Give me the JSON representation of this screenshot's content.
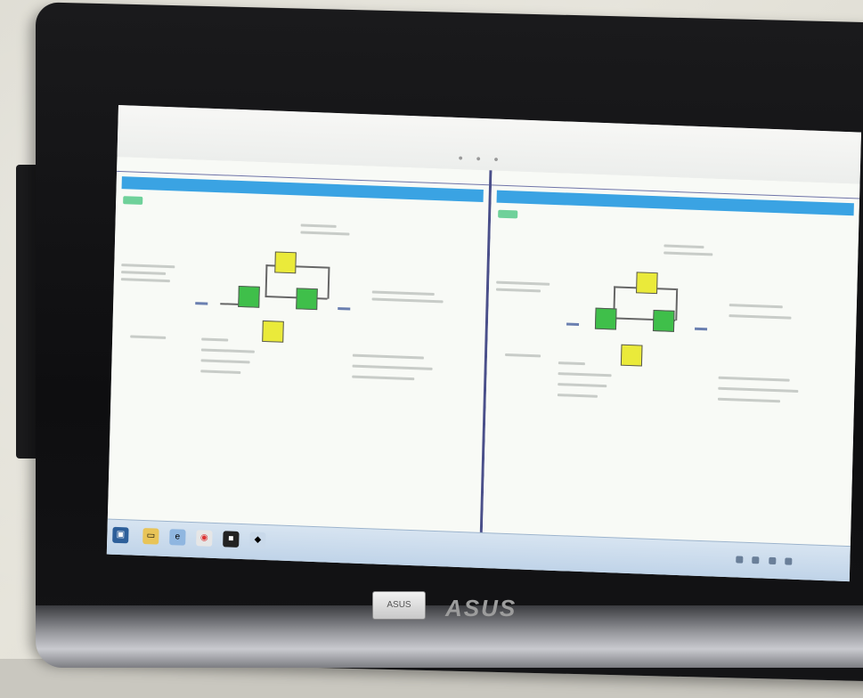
{
  "photo": {
    "brand": "ASUS",
    "power_button_label": "ASUS"
  },
  "screen": {
    "left_pane": {
      "tabs": [
        "",
        "",
        ""
      ],
      "header": ""
    },
    "right_pane": {
      "tabs": [
        "",
        "",
        ""
      ],
      "header": ""
    },
    "taskbar": {
      "items": [
        "start-icon",
        "folder-icon",
        "explorer-icon",
        "chrome-icon",
        "terminal-icon",
        "app-icon"
      ]
    }
  },
  "colors": {
    "header_bar": "#3aa3e3",
    "block_green": "#3fbf4a",
    "block_yellow": "#eaea3a",
    "divider": "#4a4f8a"
  }
}
